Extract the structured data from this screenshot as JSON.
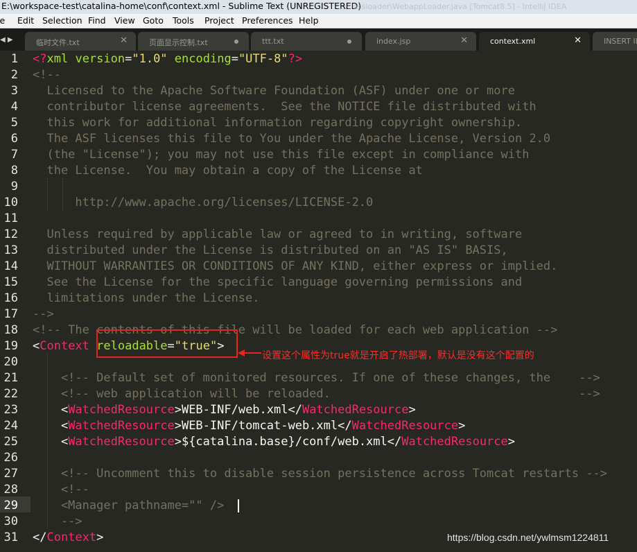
{
  "window": {
    "title": "E:\\workspace-test\\catalina-home\\conf\\context.xml - Sublime Text (UNREGISTERED)",
    "background_text": "...\\classloader\\WebappLoader.java [Tomcat8.5] - IntelliJ IDEA"
  },
  "menu": [
    {
      "label": "File",
      "display": "le"
    },
    {
      "label": "Edit",
      "display": "Edit"
    },
    {
      "label": "Selection",
      "display": "Selection"
    },
    {
      "label": "Find",
      "display": "Find"
    },
    {
      "label": "View",
      "display": "View"
    },
    {
      "label": "Goto",
      "display": "Goto"
    },
    {
      "label": "Tools",
      "display": "Tools"
    },
    {
      "label": "Project",
      "display": "Project"
    },
    {
      "label": "Preferences",
      "display": "Preferences"
    },
    {
      "label": "Help",
      "display": "Help"
    }
  ],
  "tabs": [
    {
      "label": "临时文件.txt",
      "state": "close",
      "active": false
    },
    {
      "label": "页面显示控制.txt",
      "state": "dirty",
      "active": false
    },
    {
      "label": "ttt.txt",
      "state": "dirty",
      "active": false
    },
    {
      "label": "index.jsp",
      "state": "close",
      "active": false
    },
    {
      "label": "context.xml",
      "state": "close",
      "active": true
    },
    {
      "label": "INSERT IN",
      "state": "none",
      "active": false
    }
  ],
  "tab_nav": "◀ ▶",
  "editor": {
    "current_line": 29,
    "lines": [
      {
        "n": "1",
        "t": [
          [
            "tg",
            "<?"
          ],
          [
            "at",
            "xml"
          ],
          [
            "pl",
            " "
          ],
          [
            "at",
            "version"
          ],
          [
            "pl",
            "="
          ],
          [
            "st",
            "\"1.0\""
          ],
          [
            "pl",
            " "
          ],
          [
            "at",
            "encoding"
          ],
          [
            "pl",
            "="
          ],
          [
            "st",
            "\"UTF-8\""
          ],
          [
            "tg",
            "?>"
          ]
        ]
      },
      {
        "n": "2",
        "t": [
          [
            "cm",
            "<!--"
          ]
        ]
      },
      {
        "n": "3",
        "t": [
          [
            "cm",
            "  Licensed to the Apache Software Foundation (ASF) under one or more"
          ]
        ]
      },
      {
        "n": "4",
        "t": [
          [
            "cm",
            "  contributor license agreements.  See the NOTICE file distributed with"
          ]
        ]
      },
      {
        "n": "5",
        "t": [
          [
            "cm",
            "  this work for additional information regarding copyright ownership."
          ]
        ]
      },
      {
        "n": "6",
        "t": [
          [
            "cm",
            "  The ASF licenses this file to You under the Apache License, Version 2.0"
          ]
        ]
      },
      {
        "n": "7",
        "t": [
          [
            "cm",
            "  (the \"License\"); you may not use this file except in compliance with"
          ]
        ]
      },
      {
        "n": "8",
        "t": [
          [
            "cm",
            "  the License.  You may obtain a copy of the License at"
          ]
        ]
      },
      {
        "n": "9",
        "t": []
      },
      {
        "n": "10",
        "t": [
          [
            "cm",
            "      http://www.apache.org/licenses/LICENSE-2.0"
          ]
        ]
      },
      {
        "n": "11",
        "t": []
      },
      {
        "n": "12",
        "t": [
          [
            "cm",
            "  Unless required by applicable law or agreed to in writing, software"
          ]
        ]
      },
      {
        "n": "13",
        "t": [
          [
            "cm",
            "  distributed under the License is distributed on an \"AS IS\" BASIS,"
          ]
        ]
      },
      {
        "n": "14",
        "t": [
          [
            "cm",
            "  WITHOUT WARRANTIES OR CONDITIONS OF ANY KIND, either express or implied."
          ]
        ]
      },
      {
        "n": "15",
        "t": [
          [
            "cm",
            "  See the License for the specific language governing permissions and"
          ]
        ]
      },
      {
        "n": "16",
        "t": [
          [
            "cm",
            "  limitations under the License."
          ]
        ]
      },
      {
        "n": "17",
        "t": [
          [
            "cm",
            "-->"
          ]
        ]
      },
      {
        "n": "18",
        "t": [
          [
            "cm",
            "<!-- The contents of this file will be loaded for each web application -->"
          ]
        ]
      },
      {
        "n": "19",
        "t": [
          [
            "pl",
            "<"
          ],
          [
            "tg",
            "Context"
          ],
          [
            "pl",
            " "
          ],
          [
            "at",
            "reloadable"
          ],
          [
            "pl",
            "="
          ],
          [
            "st",
            "\"true\""
          ],
          [
            "pl",
            ">"
          ]
        ]
      },
      {
        "n": "20",
        "t": []
      },
      {
        "n": "21",
        "t": [
          [
            "cm",
            "    <!-- Default set of monitored resources. If one of these changes, the    -->"
          ]
        ]
      },
      {
        "n": "22",
        "t": [
          [
            "cm",
            "    <!-- web application will be reloaded.                                   -->"
          ]
        ]
      },
      {
        "n": "23",
        "t": [
          [
            "pl",
            "    <"
          ],
          [
            "tg",
            "WatchedResource"
          ],
          [
            "pl",
            ">WEB-INF/web.xml</"
          ],
          [
            "tg",
            "WatchedResource"
          ],
          [
            "pl",
            ">"
          ]
        ]
      },
      {
        "n": "24",
        "t": [
          [
            "pl",
            "    <"
          ],
          [
            "tg",
            "WatchedResource"
          ],
          [
            "pl",
            ">WEB-INF/tomcat-web.xml</"
          ],
          [
            "tg",
            "WatchedResource"
          ],
          [
            "pl",
            ">"
          ]
        ]
      },
      {
        "n": "25",
        "t": [
          [
            "pl",
            "    <"
          ],
          [
            "tg",
            "WatchedResource"
          ],
          [
            "pl",
            ">${catalina.base}/conf/web.xml</"
          ],
          [
            "tg",
            "WatchedResource"
          ],
          [
            "pl",
            ">"
          ]
        ]
      },
      {
        "n": "26",
        "t": []
      },
      {
        "n": "27",
        "t": [
          [
            "cm",
            "    <!-- Uncomment this to disable session persistence across Tomcat restarts -->"
          ]
        ]
      },
      {
        "n": "28",
        "t": [
          [
            "cm",
            "    <!--"
          ]
        ]
      },
      {
        "n": "29",
        "t": [
          [
            "cm",
            "    <Manager pathname=\"\" />"
          ]
        ]
      },
      {
        "n": "30",
        "t": [
          [
            "cm",
            "    -->"
          ]
        ]
      },
      {
        "n": "31",
        "t": [
          [
            "pl",
            "</"
          ],
          [
            "tg",
            "Context"
          ],
          [
            "pl",
            ">"
          ]
        ]
      }
    ]
  },
  "annotation": {
    "text": "设置这个属性为true就是开启了热部署，默认是没有这个配置的",
    "color": "#ff2a2a"
  },
  "watermark": "https://blog.csdn.net/ywlmsm1224811",
  "colors": {
    "editor_bg": "#272822",
    "comment": "#75715e",
    "tag": "#f92672",
    "attribute": "#a6e22e",
    "string": "#e6db74",
    "plain": "#f8f8f2"
  }
}
